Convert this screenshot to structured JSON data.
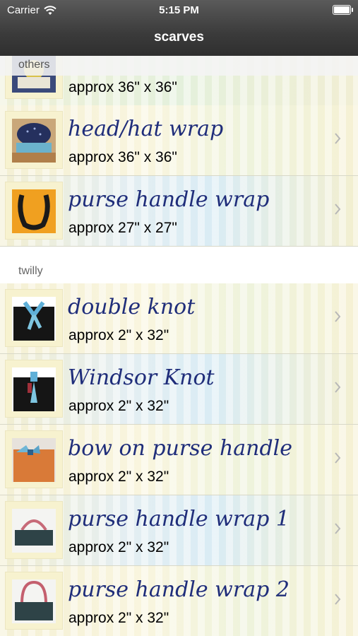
{
  "status": {
    "carrier": "Carrier",
    "time": "5:15 PM"
  },
  "nav": {
    "title": "scarves"
  },
  "sections": [
    {
      "header": "others"
    },
    {
      "header": "twilly"
    }
  ],
  "partial_row": {
    "size": "approx 36\" x 36\""
  },
  "rows": [
    {
      "title": "head/hat wrap",
      "size": "approx 36\" x 36\"",
      "thumb": "scarf-head-wrap-icon"
    },
    {
      "title": "purse handle wrap",
      "size": "approx 27\" x 27\"",
      "thumb": "purse-handle-wrap-icon"
    },
    {
      "title": "double knot",
      "size": "approx 2\" x 32\"",
      "thumb": "double-knot-icon"
    },
    {
      "title": "Windsor Knot",
      "size": "approx 2\" x 32\"",
      "thumb": "windsor-knot-icon"
    },
    {
      "title": "bow on purse handle",
      "size": "approx 2\" x 32\"",
      "thumb": "bow-purse-icon"
    },
    {
      "title": "purse handle wrap 1",
      "size": "approx 2\" x 32\"",
      "thumb": "purse-wrap-1-icon"
    },
    {
      "title": "purse handle wrap 2",
      "size": "approx 2\" x 32\"",
      "thumb": "purse-wrap-2-icon"
    }
  ]
}
